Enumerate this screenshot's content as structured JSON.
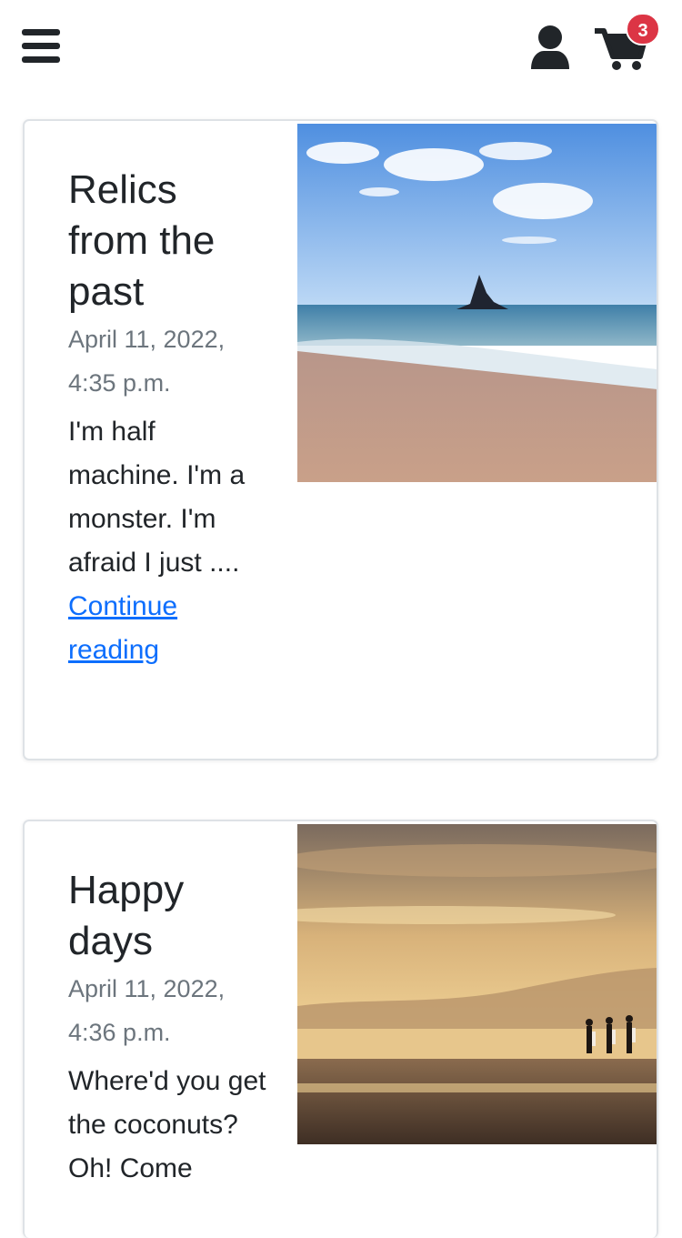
{
  "header": {
    "menu_icon": "hamburger-menu-icon",
    "user_icon": "user-icon",
    "cart_icon": "shopping-cart-icon",
    "cart_count": "3",
    "badge_color": "#dc3545"
  },
  "posts": [
    {
      "title": "Relics from the past",
      "date": "April 11, 2022, 4:35 p.m.",
      "excerpt": "I'm half machine. I'm a monster. I'm afraid I just ....",
      "link": "Continue reading",
      "image": "beach-rock-sea-photo"
    },
    {
      "title": "Happy days",
      "date": "April 11, 2022, 4:36 p.m.",
      "excerpt": "Where'd you get the coconuts? Oh! Come",
      "image": "sunset-beach-surfers-photo"
    }
  ],
  "colors": {
    "text": "#212529",
    "muted": "#6c757d",
    "link": "#0d6efd",
    "border": "#dee2e6"
  }
}
